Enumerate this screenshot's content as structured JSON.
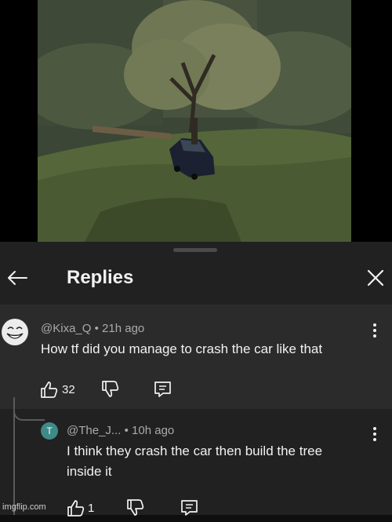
{
  "header": {
    "title": "Replies"
  },
  "parent_comment": {
    "author": "@Kixa_Q",
    "time": "21h ago",
    "text": "How tf did you manage to crash the car like that",
    "likes": "32"
  },
  "reply": {
    "avatar_letter": "T",
    "author": "@The_J...",
    "time": "10h ago",
    "text_line1": "I think they crash the car then build the tree",
    "text_line2": "inside it",
    "likes": "1"
  },
  "separator": "•",
  "watermark": "imgflip.com",
  "icons": [
    "back-arrow-icon",
    "close-icon",
    "thumbs-up-icon",
    "thumbs-down-icon",
    "reply-comment-icon",
    "more-vertical-icon"
  ],
  "colors": {
    "panel": "#212121",
    "highlight": "#2b2b2b",
    "reply_avatar": "#3f8a88"
  }
}
